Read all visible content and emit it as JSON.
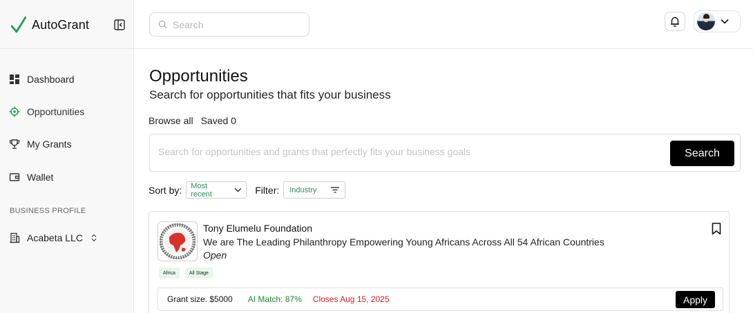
{
  "brand": {
    "name": "AutoGrant",
    "accent": "#2a9d5c"
  },
  "sidebar": {
    "items": [
      {
        "label": "Dashboard",
        "icon": "grid-icon"
      },
      {
        "label": "Opportunities",
        "icon": "target-icon"
      },
      {
        "label": "My Grants",
        "icon": "trophy-icon"
      },
      {
        "label": "Wallet",
        "icon": "wallet-icon"
      }
    ],
    "section_title": "BUSINESS PROFILE",
    "business": {
      "label": "Acabeta LLC",
      "icon": "building-icon"
    }
  },
  "topbar": {
    "search_placeholder": "Search"
  },
  "page": {
    "title": "Opportunities",
    "subtitle": "Search for opportunities that fits your business",
    "tabs": [
      {
        "label": "Browse all"
      },
      {
        "label": "Saved 0"
      }
    ],
    "search_placeholder": "Search for opportunities and grants that perfectly fits your business goals",
    "search_button": "Search",
    "sort_label": "Sort by:",
    "sort_value": "Most recent",
    "filter_label": "Filter:",
    "filter_value": "Industry"
  },
  "opportunity": {
    "name": "Tony Elumelu Foundation",
    "description": "We are The Leading Philanthropy Empowering Young Africans Across All 54 African Countries",
    "status": "Open",
    "tags": [
      "Africa",
      "All Stage"
    ],
    "grant_size": "Grant size. $5000",
    "ai_match": "AI Match: 87%",
    "closes": "Closes Aug 15, 2025",
    "apply_label": "Apply",
    "colors": {
      "ai_match": "#1c8a2e",
      "closes": "#d42020"
    }
  }
}
